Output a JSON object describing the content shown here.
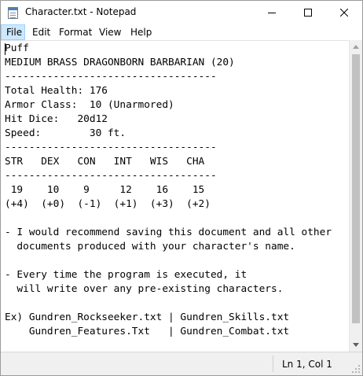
{
  "window": {
    "title": "Character.txt - Notepad",
    "icon": "notepad-icon",
    "controls": [
      "minimize-icon",
      "maximize-icon",
      "close-icon"
    ]
  },
  "menu": {
    "file": "File",
    "edit": "Edit",
    "format": "Format",
    "view": "View",
    "help": "Help"
  },
  "document": {
    "content": "Puff\nMEDIUM BRASS DRAGONBORN BARBARIAN (20)\n-----------------------------------\nTotal Health: 176\nArmor Class:  10 (Unarmored)\nHit Dice:   20d12\nSpeed:        30 ft.\n-----------------------------------\nSTR   DEX   CON   INT   WIS   CHA\n-----------------------------------\n 19    10    9     12    16    15\n(+4)  (+0)  (-1)  (+1)  (+3)  (+2)\n\n- I would recommend saving this document and all other\n  documents produced with your character's name.\n\n- Every time the program is executed, it\n  will write over any pre-existing characters.\n\nEx) Gundren_Rockseeker.txt | Gundren_Skills.txt\n    Gundren_Features.Txt   | Gundren_Combat.txt"
  },
  "status": {
    "position": "Ln 1, Col 1"
  }
}
